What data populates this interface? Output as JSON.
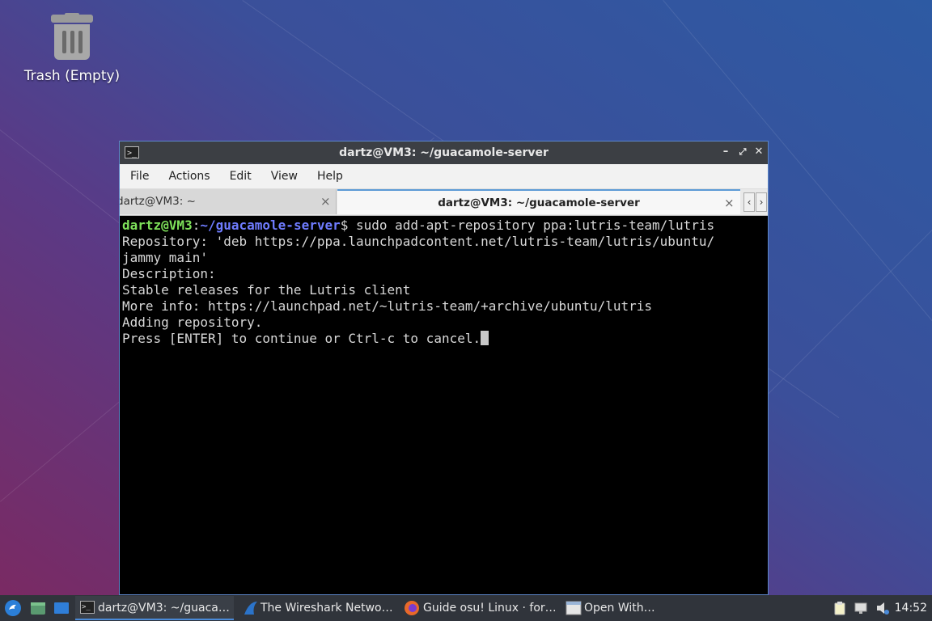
{
  "desktop": {
    "trash_label": "Trash (Empty)"
  },
  "window": {
    "title": "dartz@VM3: ~/guacamole-server",
    "menu": [
      "File",
      "Actions",
      "Edit",
      "View",
      "Help"
    ],
    "tabs": [
      {
        "label": "dartz@VM3: ~",
        "active": false
      },
      {
        "label": "dartz@VM3: ~/guacamole-server",
        "active": true
      }
    ],
    "close_glyph": "×"
  },
  "terminal": {
    "prompt_user": "dartz@VM3",
    "prompt_sep": ":",
    "prompt_path": "~/guacamole-server",
    "prompt_dollar": "$ ",
    "command": "sudo add-apt-repository ppa:lutris-team/lutris",
    "lines": [
      "Repository: 'deb https://ppa.launchpadcontent.net/lutris-team/lutris/ubuntu/",
      "jammy main'",
      "Description:",
      "Stable releases for the Lutris client",
      "More info: https://launchpad.net/~lutris-team/+archive/ubuntu/lutris",
      "Adding repository.",
      "Press [ENTER] to continue or Ctrl-c to cancel."
    ]
  },
  "taskbar": {
    "tasks": [
      {
        "label": "dartz@VM3: ~/guaca…",
        "icon": "terminal-icon",
        "active": true
      },
      {
        "label": "The Wireshark Netwo…",
        "icon": "wireshark-icon",
        "active": false
      },
      {
        "label": "Guide osu! Linux · for…",
        "icon": "firefox-icon",
        "active": false
      },
      {
        "label": "Open With…",
        "icon": "window-icon",
        "active": false
      }
    ],
    "clock": "14:52"
  },
  "colors": {
    "prompt_user": "#7ee15a",
    "prompt_path": "#6f7cff",
    "window_border": "#5c86c8",
    "taskbar": "#30343b"
  }
}
